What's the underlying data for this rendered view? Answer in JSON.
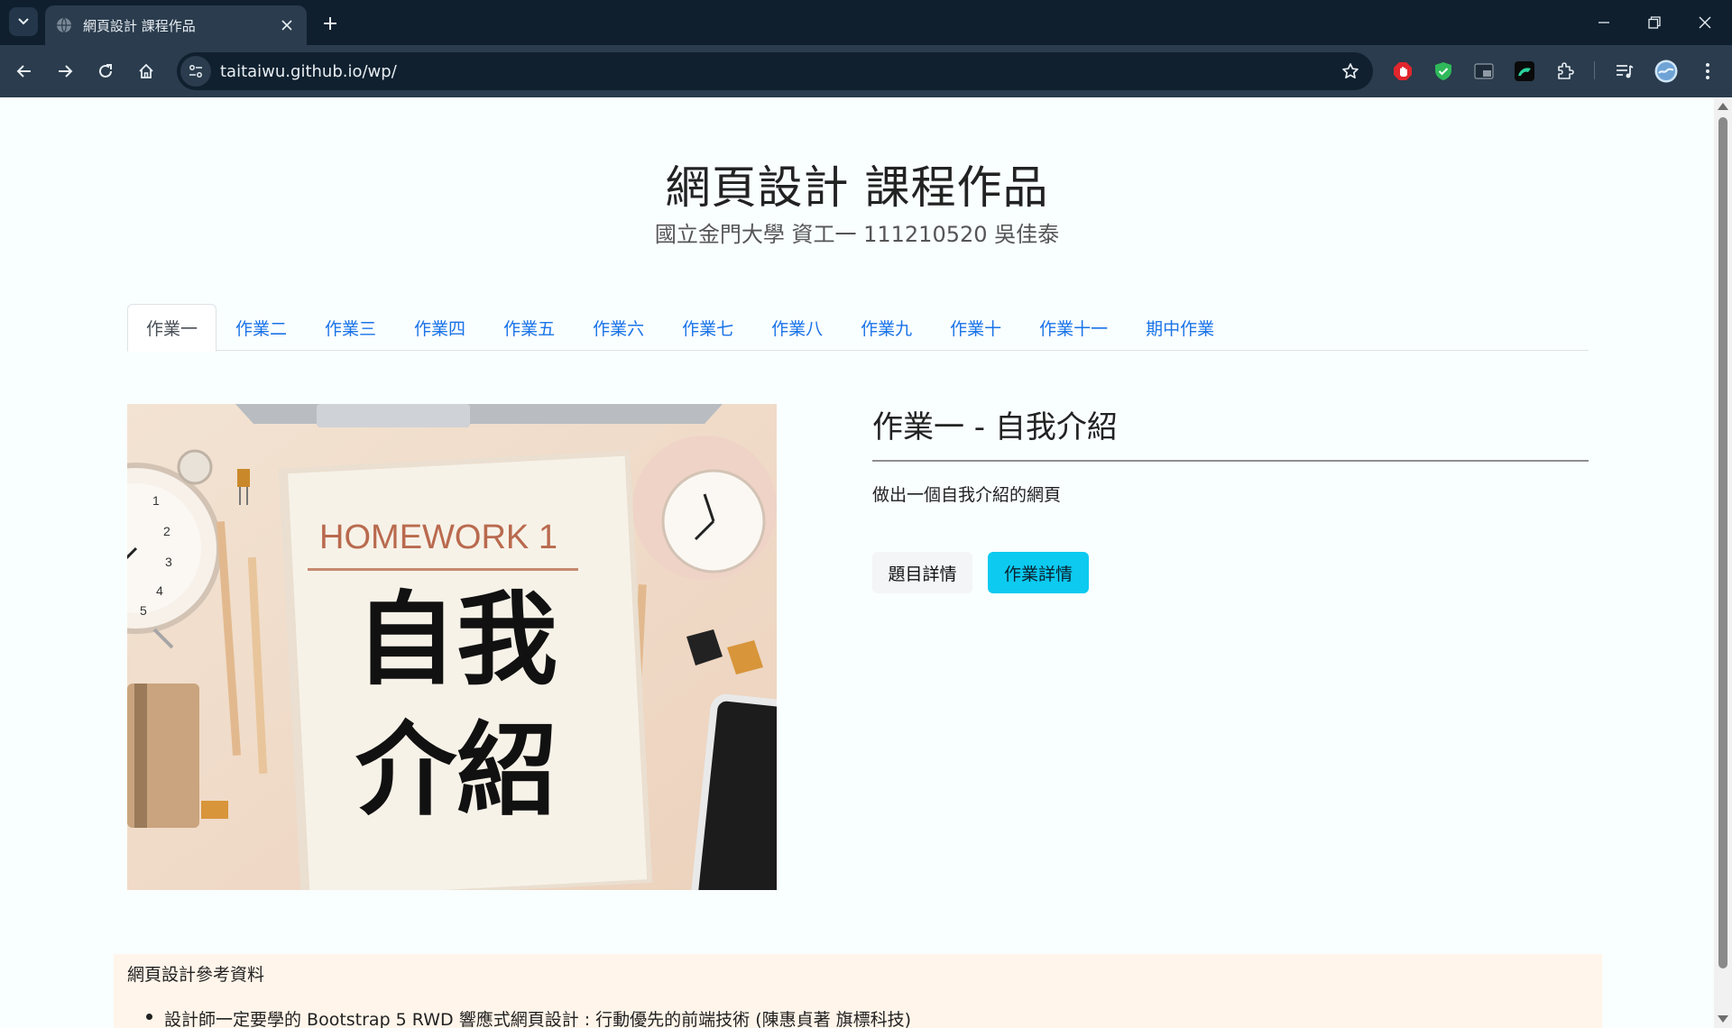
{
  "browser": {
    "tab_title": "網頁設計 課程作品",
    "url": "taitaiwu.github.io/wp/"
  },
  "header": {
    "title": "網頁設計 課程作品",
    "subtitle": "國立金門大學 資工一 111210520 吳佳泰"
  },
  "tabs": [
    {
      "label": "作業一"
    },
    {
      "label": "作業二"
    },
    {
      "label": "作業三"
    },
    {
      "label": "作業四"
    },
    {
      "label": "作業五"
    },
    {
      "label": "作業六"
    },
    {
      "label": "作業七"
    },
    {
      "label": "作業八"
    },
    {
      "label": "作業九"
    },
    {
      "label": "作業十"
    },
    {
      "label": "作業十一"
    },
    {
      "label": "期中作業"
    }
  ],
  "hero_image": {
    "heading": "HOMEWORK 1",
    "line1": "自我",
    "line2": "介紹"
  },
  "assignment": {
    "title": "作業一 - 自我介紹",
    "description": "做出一個自我介紹的網頁",
    "details_button": "題目詳情",
    "homework_button": "作業詳情"
  },
  "references": {
    "title": "網頁設計參考資料",
    "items": [
      "設計師一定要學的 Bootstrap 5 RWD 響應式網頁設計 : 行動優先的前端技術 (陳惠貞著 旗標科技)"
    ]
  },
  "colors": {
    "tab_link": "#1a73e8",
    "info_button": "#0dcaf0",
    "chrome_dark": "#0f1f2e",
    "chrome_toolbar": "#2a3c4d",
    "reference_bg": "#fff5ea"
  }
}
